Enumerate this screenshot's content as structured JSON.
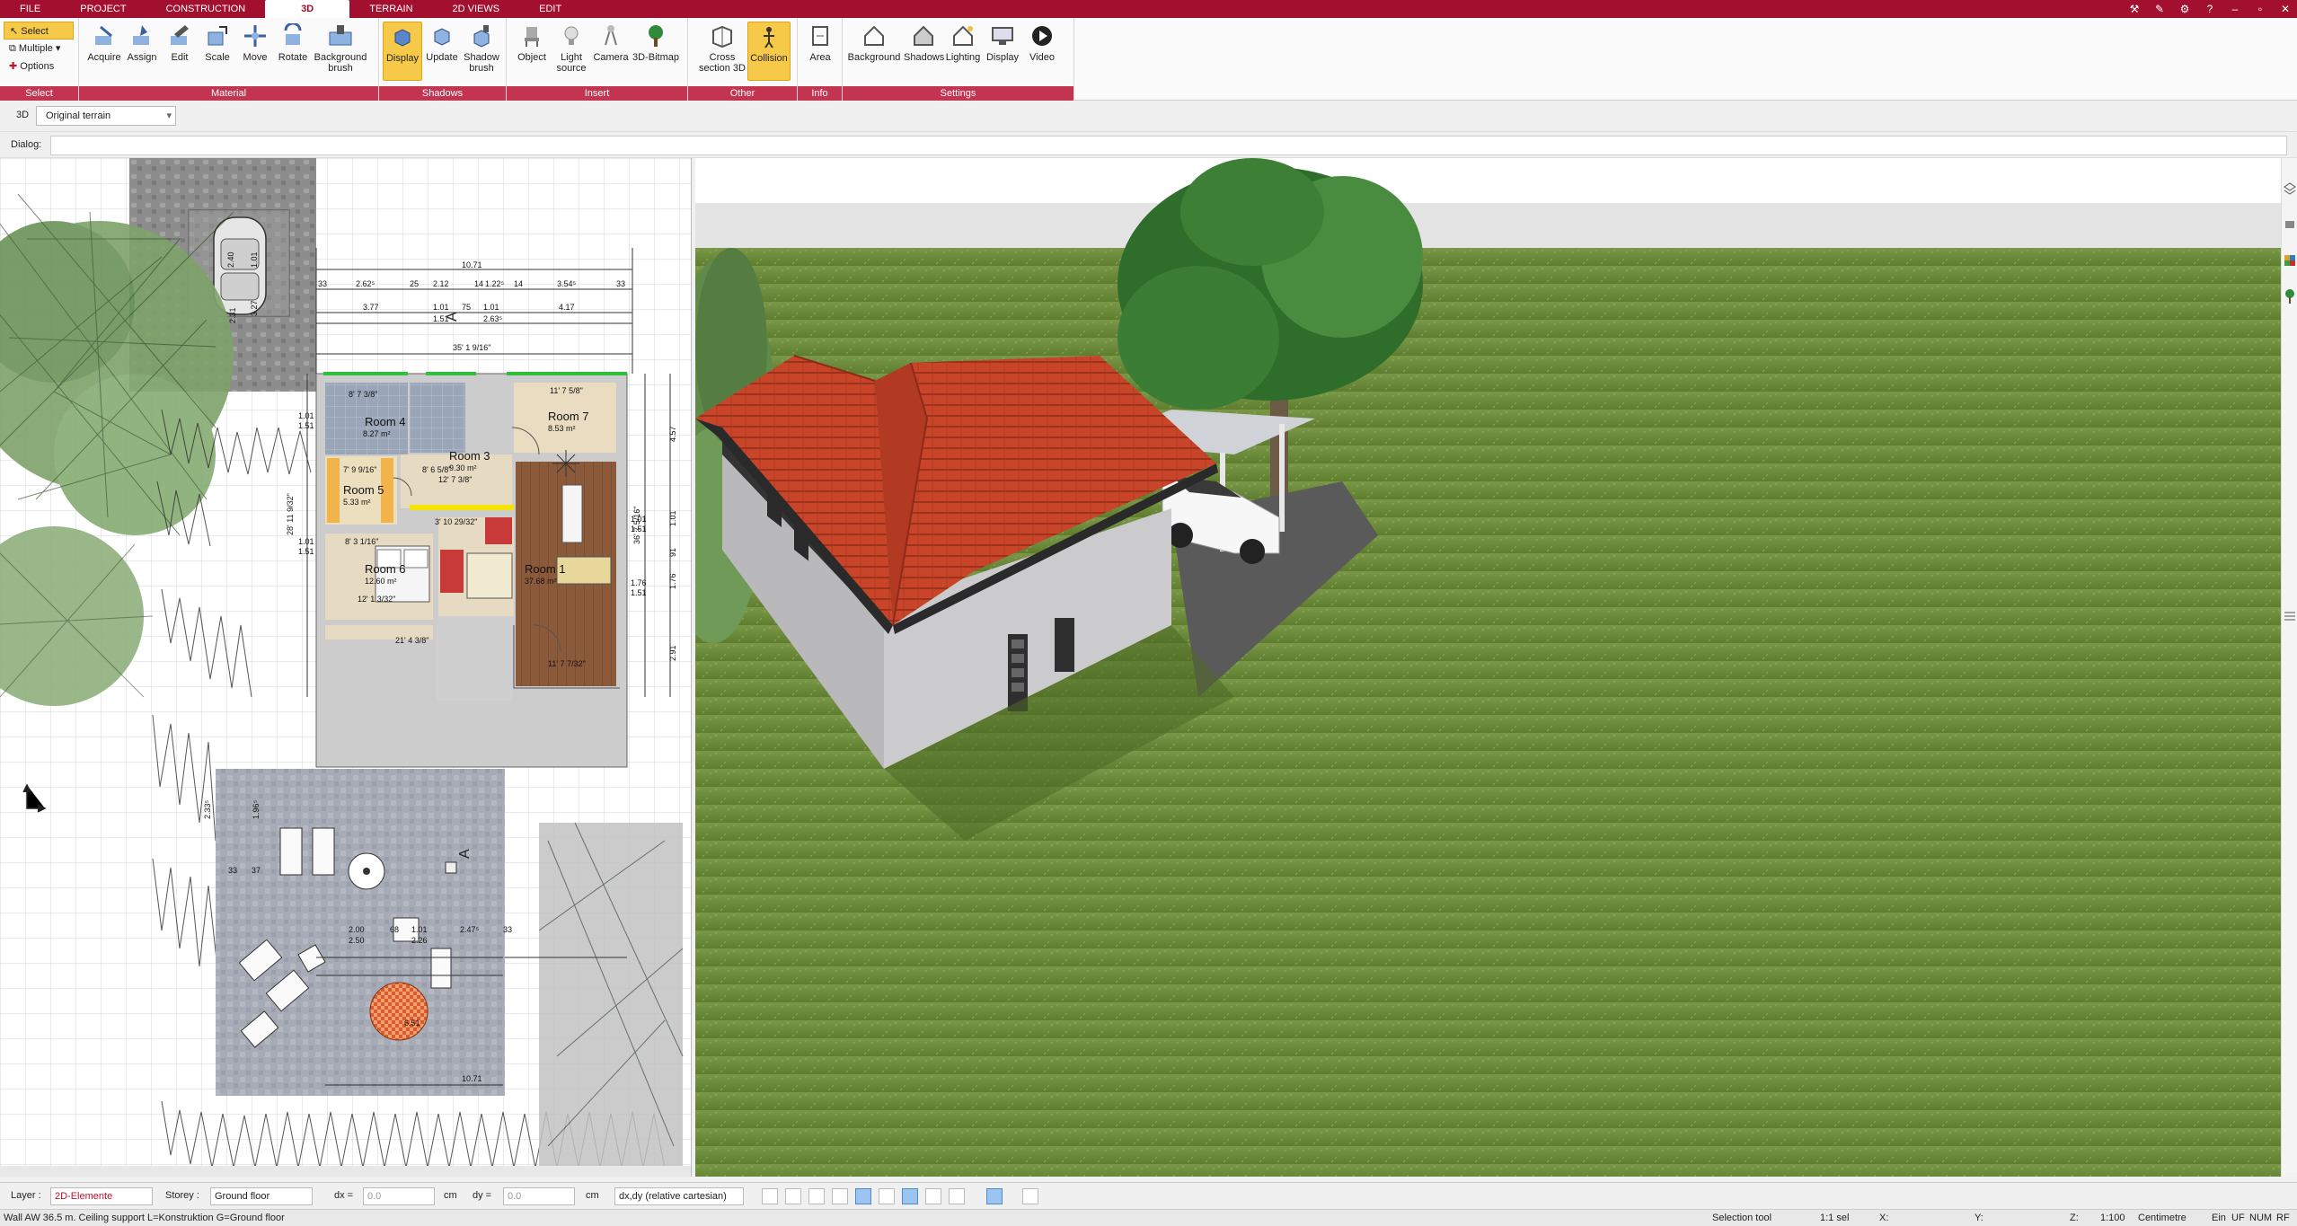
{
  "menu": {
    "tabs": [
      {
        "label": "FILE"
      },
      {
        "label": "PROJECT"
      },
      {
        "label": "CONSTRUCTION"
      },
      {
        "label": "3D"
      },
      {
        "label": "TERRAIN"
      },
      {
        "label": "2D VIEWS"
      },
      {
        "label": "EDIT"
      }
    ],
    "active_tab": "3D"
  },
  "ribbon": {
    "select_group": {
      "label": "Select",
      "select": "Select",
      "multiple": "Multiple",
      "options": "Options"
    },
    "material_group": {
      "label": "Material",
      "acquire": "Acquire",
      "assign": "Assign",
      "edit": "Edit",
      "scale": "Scale",
      "move": "Move",
      "rotate": "Rotate",
      "background_brush": "Background brush"
    },
    "shadows_group": {
      "label": "Shadows",
      "display": "Display",
      "update": "Update",
      "shadow_brush": "Shadow brush"
    },
    "insert_group": {
      "label": "Insert",
      "object": "Object",
      "light_source": "Light source",
      "camera": "Camera",
      "bitmap": "3D-Bitmap"
    },
    "other_group": {
      "label": "Other",
      "cross_section": "Cross section 3D",
      "collision": "Collision"
    },
    "info_group": {
      "label": "Info",
      "area": "Area"
    },
    "settings_group": {
      "label": "Settings",
      "background": "Background",
      "shadows": "Shadows",
      "lighting": "Lighting",
      "display": "Display",
      "video": "Video"
    }
  },
  "bar3d": {
    "label": "3D",
    "terrain": "Original terrain"
  },
  "dialog": {
    "label": "Dialog:"
  },
  "plan": {
    "dims_top": {
      "total": "10.71",
      "row1": [
        "33",
        "2.62⁵",
        "25",
        "2.12",
        "14",
        "1.22⁵",
        "14",
        "3.54⁵",
        "33"
      ],
      "row2": [
        "3.77",
        "1.01",
        "75",
        "1.01",
        "4.17"
      ],
      "row2b": [
        "1.51",
        "2.63⁵"
      ],
      "arrow": "35' 1 9/16\""
    },
    "rooms": [
      {
        "name": "Room 4",
        "area": "8.27 m²"
      },
      {
        "name": "Room 7",
        "area": "8.53 m²"
      },
      {
        "name": "Room 3",
        "area": "9.30 m²"
      },
      {
        "name": "Room 5",
        "area": "5.33 m²"
      },
      {
        "name": "Room 6",
        "area": "12.60 m²"
      },
      {
        "name": "Room 1",
        "area": "37.68 m²"
      }
    ],
    "room_dims": [
      "8' 7 3/8\"",
      "11' 7 5/8\"",
      "8' 6 5/8\"",
      "12' 7 3/8\"",
      "7' 9 9/16\"",
      "8' 3 1/16\"",
      "12' 1 3/32\"",
      "11' 7 7/32\"",
      "21' 4 3/8\"",
      "3' 10 29/32\""
    ],
    "dims_right": [
      "4.57",
      "1.01",
      "91",
      "1.76",
      "2.91"
    ],
    "dims_right2": [
      "1.01",
      "1.51",
      "1.76",
      "1.51"
    ],
    "dims_left": [
      "1.01",
      "1.51",
      "1.01",
      "1.51"
    ],
    "vertical_left": "28' 11 9/32\"",
    "vertical_right": "36' 7 5/16\"",
    "terrace": {
      "dims": [
        "2.00",
        "2.50",
        "68",
        "1.01",
        "2.26",
        "2.47⁵",
        "33"
      ],
      "table_dim": "6.51",
      "bottom": "10.71",
      "side": [
        "2.33⁵",
        "1.96⁵",
        "33",
        "37"
      ]
    },
    "carport": [
      "2.40",
      "1.01",
      "3.27",
      "2.31"
    ]
  },
  "inputbar": {
    "layer_label": "Layer :",
    "layer_value": "2D-Elemente",
    "storey_label": "Storey :",
    "storey_value": "Ground floor",
    "dx_label": "dx =",
    "dx_value": "0.0",
    "dx_unit": "cm",
    "dy_label": "dy =",
    "dy_value": "0.0",
    "dy_unit": "cm",
    "mode": "dx,dy (relative cartesian)"
  },
  "statusbar": {
    "message": "Wall AW 36.5 m. Ceiling support L=Konstruktion G=Ground floor",
    "tool": "Selection tool",
    "x": "X:",
    "y": "Y:",
    "z": "Z:",
    "scale": "1:100",
    "sel": "1:1 sel",
    "unit": "Centimetre",
    "ein": "Ein",
    "uf": "UF",
    "num": "NUM",
    "rf": "RF"
  },
  "colors": {
    "menubar": "#a3102f",
    "group_label": "#c2344f",
    "active_tool": "#f7c948",
    "roof": "#c8452a",
    "wall": "#c9c9cb",
    "grass": "#6d8b3a",
    "sky": "#ffffff"
  }
}
